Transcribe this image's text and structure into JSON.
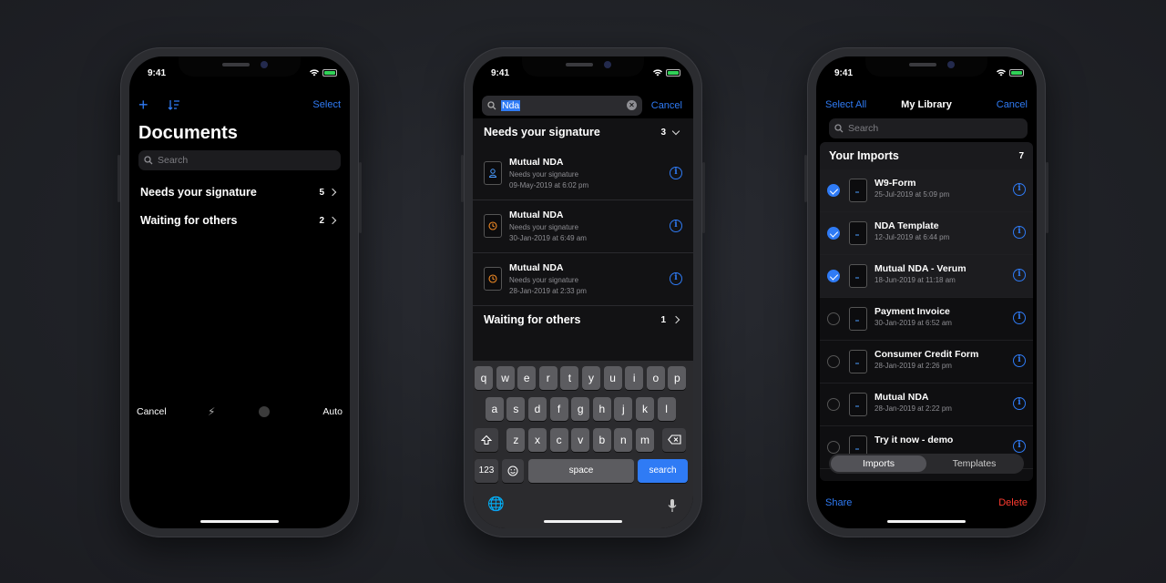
{
  "status": {
    "time": "9:41"
  },
  "colors": {
    "accent": "#2f7bf5",
    "destructive": "#ff3b30",
    "background": "#000000"
  },
  "documents_screen": {
    "select_label": "Select",
    "title": "Documents",
    "search_placeholder": "Search",
    "sections": [
      {
        "label": "Needs your signature",
        "count": "5"
      },
      {
        "label": "Waiting for others",
        "count": "2"
      }
    ],
    "camera_bar": {
      "cancel": "Cancel",
      "auto": "Auto"
    }
  },
  "search_screen": {
    "query": "Nda",
    "cancel_label": "Cancel",
    "section_needs": {
      "label": "Needs your signature",
      "count": "3"
    },
    "results": [
      {
        "title": "Mutual NDA",
        "status": "Needs your signature",
        "date": "09-May-2019 at 6:02 pm",
        "icon": "person-icon"
      },
      {
        "title": "Mutual NDA",
        "status": "Needs your signature",
        "date": "30-Jan-2019 at 6:49 am",
        "icon": "clock-icon"
      },
      {
        "title": "Mutual NDA",
        "status": "Needs your signature",
        "date": "28-Jan-2019 at 2:33 pm",
        "icon": "clock-icon"
      }
    ],
    "section_waiting": {
      "label": "Waiting for others",
      "count": "1"
    },
    "keyboard": {
      "row1": [
        "q",
        "w",
        "e",
        "r",
        "t",
        "y",
        "u",
        "i",
        "o",
        "p"
      ],
      "row2": [
        "a",
        "s",
        "d",
        "f",
        "g",
        "h",
        "j",
        "k",
        "l"
      ],
      "row3": [
        "z",
        "x",
        "c",
        "v",
        "b",
        "n",
        "m"
      ],
      "num_key": "123",
      "space_key": "space",
      "search_key": "search"
    }
  },
  "library_screen": {
    "select_all_label": "Select All",
    "title": "My Library",
    "cancel_label": "Cancel",
    "search_placeholder": "Search",
    "section": {
      "label": "Your Imports",
      "count": "7"
    },
    "items": [
      {
        "title": "W9-Form",
        "date": "25-Jul-2019 at 5:09 pm",
        "selected": true
      },
      {
        "title": "NDA Template",
        "date": "12-Jul-2019 at 6:44 pm",
        "selected": true
      },
      {
        "title": "Mutual NDA - Verum",
        "date": "18-Jun-2019 at 11:18 am",
        "selected": true
      },
      {
        "title": "Payment Invoice",
        "date": "30-Jan-2019 at 6:52 am",
        "selected": false
      },
      {
        "title": "Consumer Credit Form",
        "date": "28-Jan-2019 at 2:26 pm",
        "selected": false
      },
      {
        "title": "Mutual NDA",
        "date": "28-Jan-2019 at 2:22 pm",
        "selected": false
      },
      {
        "title": "Try it now - demo",
        "date": "",
        "selected": false
      }
    ],
    "segments": [
      "Imports",
      "Templates"
    ],
    "share_label": "Share",
    "delete_label": "Delete"
  }
}
